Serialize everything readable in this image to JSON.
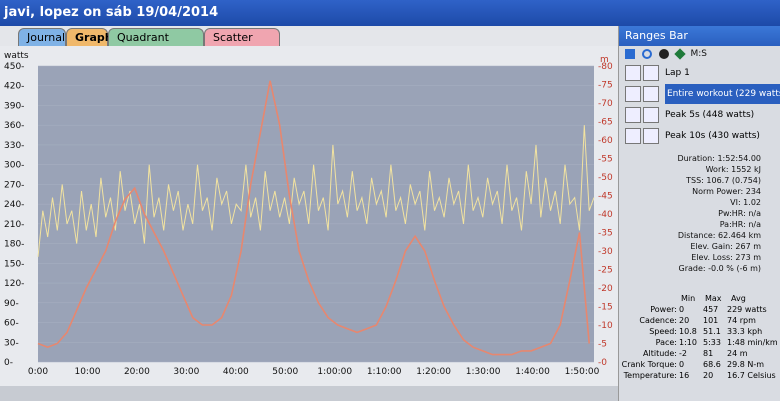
{
  "window": {
    "title": "javi, lopez on sáb 19/04/2014"
  },
  "tabs": [
    {
      "label": "Journal"
    },
    {
      "label": "Graph"
    },
    {
      "label": "Quadrant Analysis"
    },
    {
      "label": "Scatter Graph"
    }
  ],
  "nav": {
    "prev": "◀",
    "play": "▶",
    "next": "▶",
    "close": "✕"
  },
  "chart_data": {
    "type": "line",
    "title": "",
    "ylabel_left": "watts",
    "ylabel_right": "m",
    "x_ticks": [
      "0:00",
      "10:00",
      "20:00",
      "30:00",
      "40:00",
      "50:00",
      "1:00:00",
      "1:10:00",
      "1:20:00",
      "1:30:00",
      "1:40:00",
      "1:50:00"
    ],
    "y_left_ticks": [
      "450-",
      "420-",
      "390-",
      "360-",
      "330-",
      "300-",
      "270-",
      "240-",
      "210-",
      "180-",
      "150-",
      "120-",
      "90-",
      "60-",
      "30-",
      "0-"
    ],
    "y_right_ticks": [
      "-80",
      "-75",
      "-70",
      "-65",
      "-60",
      "-55",
      "-50",
      "-45",
      "-40",
      "-35",
      "-30",
      "-25",
      "-20",
      "-15",
      "-10",
      "-5",
      "-0"
    ],
    "xlim": [
      0,
      115
    ],
    "ylim_left": [
      0,
      450
    ],
    "ylim_right": [
      0,
      80
    ],
    "series": [
      {
        "name": "Power",
        "axis": "left",
        "color": "#f2e3a0",
        "x": [
          0,
          1,
          2,
          3,
          4,
          5,
          6,
          7,
          8,
          9,
          10,
          11,
          12,
          13,
          14,
          15,
          16,
          17,
          18,
          19,
          20,
          21,
          22,
          23,
          24,
          25,
          26,
          27,
          28,
          29,
          30,
          31,
          32,
          33,
          34,
          35,
          36,
          37,
          38,
          39,
          40,
          41,
          42,
          43,
          44,
          45,
          46,
          47,
          48,
          49,
          50,
          51,
          52,
          53,
          54,
          55,
          56,
          57,
          58,
          59,
          60,
          61,
          62,
          63,
          64,
          65,
          66,
          67,
          68,
          69,
          70,
          71,
          72,
          73,
          74,
          75,
          76,
          77,
          78,
          79,
          80,
          81,
          82,
          83,
          84,
          85,
          86,
          87,
          88,
          89,
          90,
          91,
          92,
          93,
          94,
          95,
          96,
          97,
          98,
          99,
          100,
          101,
          102,
          103,
          104,
          105,
          106,
          107,
          108,
          109,
          110,
          111,
          112,
          113,
          114,
          115
        ],
        "y": [
          160,
          230,
          190,
          250,
          200,
          270,
          210,
          230,
          180,
          260,
          200,
          240,
          190,
          280,
          220,
          250,
          200,
          290,
          230,
          260,
          210,
          240,
          180,
          300,
          220,
          250,
          200,
          270,
          230,
          260,
          200,
          240,
          210,
          300,
          230,
          250,
          200,
          280,
          240,
          260,
          210,
          240,
          230,
          300,
          220,
          250,
          200,
          290,
          230,
          260,
          220,
          250,
          210,
          280,
          240,
          260,
          210,
          300,
          230,
          250,
          200,
          330,
          240,
          260,
          220,
          290,
          230,
          250,
          210,
          280,
          240,
          260,
          220,
          300,
          230,
          250,
          210,
          270,
          240,
          260,
          200,
          290,
          230,
          250,
          220,
          280,
          240,
          260,
          210,
          300,
          230,
          250,
          220,
          280,
          240,
          260,
          210,
          300,
          230,
          250,
          200,
          290,
          240,
          330,
          220,
          280,
          230,
          260,
          210,
          300,
          240,
          250,
          200,
          360,
          230,
          250
        ]
      },
      {
        "name": "Altitude",
        "axis": "right",
        "color": "#e7876f",
        "x": [
          0,
          2,
          4,
          6,
          8,
          10,
          12,
          14,
          16,
          18,
          20,
          22,
          24,
          26,
          28,
          30,
          32,
          34,
          36,
          38,
          40,
          42,
          44,
          46,
          48,
          50,
          52,
          54,
          56,
          58,
          60,
          62,
          64,
          66,
          68,
          70,
          72,
          74,
          76,
          78,
          80,
          82,
          84,
          86,
          88,
          90,
          92,
          94,
          96,
          98,
          100,
          102,
          104,
          106,
          108,
          110,
          112,
          114
        ],
        "y": [
          5,
          4,
          5,
          8,
          14,
          20,
          25,
          30,
          38,
          44,
          47,
          40,
          35,
          30,
          24,
          18,
          12,
          10,
          10,
          12,
          18,
          30,
          48,
          62,
          76,
          64,
          45,
          30,
          22,
          16,
          12,
          10,
          9,
          8,
          9,
          10,
          15,
          22,
          30,
          34,
          30,
          22,
          15,
          10,
          6,
          4,
          3,
          2,
          2,
          2,
          3,
          3,
          4,
          5,
          10,
          22,
          35,
          5
        ]
      }
    ]
  },
  "ranges_bar": {
    "title": "Ranges Bar",
    "toolbar_label": "M:S",
    "ranges": [
      {
        "label": "Lap 1"
      },
      {
        "label": "Entire workout (229 watts)"
      },
      {
        "label": "Peak 5s (448 watts)"
      },
      {
        "label": "Peak 10s (430 watts)"
      }
    ],
    "stats": [
      "Duration: 1:52:54.00",
      "Work: 1552 kJ",
      "TSS: 106.7 (0.754)",
      "Norm Power: 234",
      "VI: 1.02",
      "Pw:HR: n/a",
      "Pa:HR: n/a",
      "Distance: 62.464 km",
      "Elev. Gain: 267 m",
      "Elev. Loss: 273 m",
      "Grade: -0.0 % (-6 m)"
    ],
    "table": {
      "headers": [
        "Min",
        "Max",
        "Avg"
      ],
      "rows": [
        [
          "Power:",
          "0",
          "457",
          "229 watts"
        ],
        [
          "Cadence:",
          "20",
          "101",
          "74 rpm"
        ],
        [
          "Speed:",
          "10.8",
          "51.1",
          "33.3 kph"
        ],
        [
          "Pace:",
          "1:10",
          "5:33",
          "1:48 min/km"
        ],
        [
          "Altitude:",
          "-2",
          "81",
          "24 m"
        ],
        [
          "Crank Torque:",
          "0",
          "68.6",
          "29.8 N-m"
        ],
        [
          "Temperature:",
          "16",
          "20",
          "16.7 Celsius"
        ]
      ]
    }
  }
}
